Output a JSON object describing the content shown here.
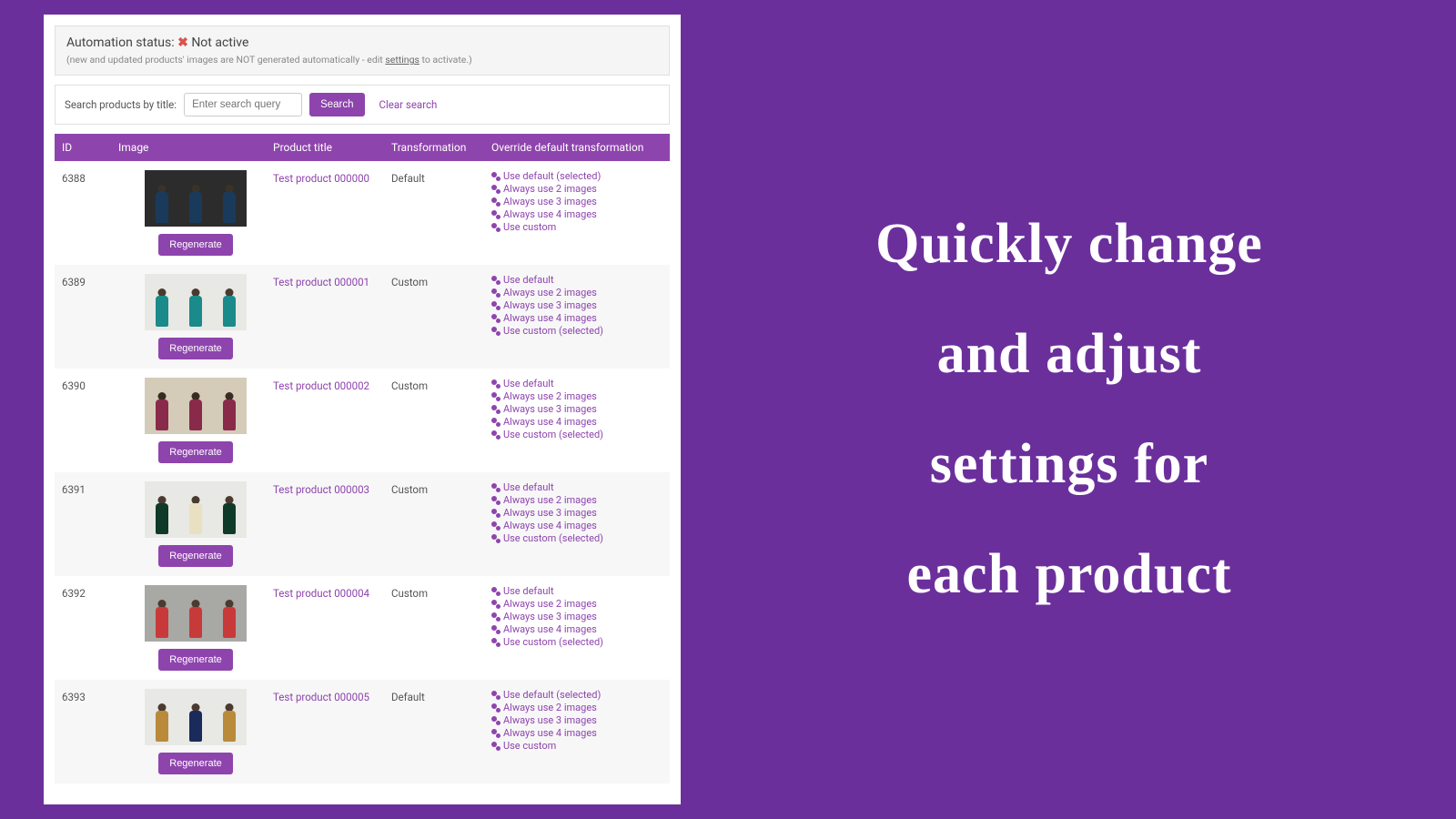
{
  "status": {
    "label": "Automation status:",
    "x": "✖",
    "value": "Not active",
    "note_pre": "(new and updated products' images are NOT generated automatically - edit ",
    "note_link": "settings",
    "note_post": " to activate.)"
  },
  "search": {
    "label": "Search products by title:",
    "placeholder": "Enter search query",
    "button": "Search",
    "clear": "Clear search"
  },
  "columns": {
    "id": "ID",
    "image": "Image",
    "title": "Product title",
    "transformation": "Transformation",
    "override": "Override default transformation"
  },
  "regenerate_label": "Regenerate",
  "override_options": {
    "use_default": "Use default",
    "use_default_selected": "Use default (selected)",
    "always2": "Always use 2 images",
    "always3": "Always use 3 images",
    "always4": "Always use 4 images",
    "use_custom": "Use custom",
    "use_custom_selected": "Use custom (selected)"
  },
  "rows": [
    {
      "id": "6388",
      "title": "Test product 000000",
      "transformation": "Default",
      "selected": "default",
      "thumb_bg": "bg-dark",
      "fig_class": "c-navy"
    },
    {
      "id": "6389",
      "title": "Test product 000001",
      "transformation": "Custom",
      "selected": "custom",
      "thumb_bg": "bg-light",
      "fig_class": "c-teal"
    },
    {
      "id": "6390",
      "title": "Test product 000002",
      "transformation": "Custom",
      "selected": "custom",
      "thumb_bg": "bg-beige",
      "fig_class": "c-maroon"
    },
    {
      "id": "6391",
      "title": "Test product 000003",
      "transformation": "Custom",
      "selected": "custom",
      "thumb_bg": "bg-light",
      "fig_class": "c-dgreen",
      "fig_class2": "c-cream"
    },
    {
      "id": "6392",
      "title": "Test product 000004",
      "transformation": "Custom",
      "selected": "custom",
      "thumb_bg": "bg-gray",
      "fig_class": "c-red"
    },
    {
      "id": "6393",
      "title": "Test product 000005",
      "transformation": "Default",
      "selected": "default",
      "thumb_bg": "bg-light",
      "fig_class": "c-mustard",
      "fig_class2": "c-dblue"
    }
  ],
  "marketing": {
    "line1": "Quickly change",
    "line2": "and adjust",
    "line3": "settings for",
    "line4": "each product"
  }
}
